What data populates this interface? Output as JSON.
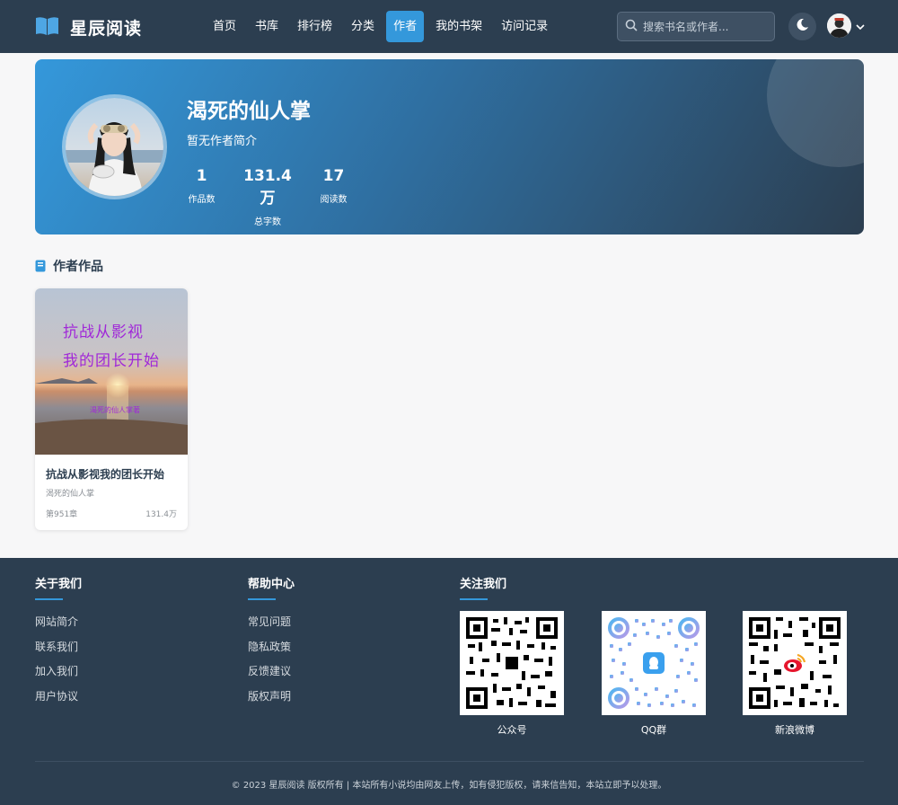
{
  "nav": {
    "logo_text": "星辰阅读",
    "menu": [
      {
        "label": "首页",
        "active": false
      },
      {
        "label": "书库",
        "active": false
      },
      {
        "label": "排行榜",
        "active": false
      },
      {
        "label": "分类",
        "active": false
      },
      {
        "label": "作者",
        "active": true
      },
      {
        "label": "我的书架",
        "active": false
      },
      {
        "label": "访问记录",
        "active": false
      }
    ],
    "search_placeholder": "搜索书名或作者...",
    "icons": [
      "book-open-icon",
      "search-icon",
      "moon-icon",
      "chevron-down-icon"
    ]
  },
  "author": {
    "name": "渴死的仙人掌",
    "intro": "暂无作者简介",
    "stats": [
      {
        "value": "1",
        "label": "作品数"
      },
      {
        "value": "131.4万",
        "label": "总字数"
      },
      {
        "value": "17",
        "label": "阅读数"
      }
    ]
  },
  "works": {
    "title": "作者作品",
    "books": [
      {
        "title": "抗战从影视我的团长开始",
        "author": "渴死的仙人掌",
        "chapter": "第951章",
        "words": "131.4万",
        "cover_line1": "抗战从影视",
        "cover_line2": "我的团长开始",
        "cover_author": "渴死的仙人掌",
        "cover_author_suffix": "著"
      }
    ]
  },
  "footer": {
    "about": {
      "title": "关于我们",
      "links": [
        "网站简介",
        "联系我们",
        "加入我们",
        "用户协议"
      ]
    },
    "help": {
      "title": "帮助中心",
      "links": [
        "常见问题",
        "隐私政策",
        "反馈建议",
        "版权声明"
      ]
    },
    "follow": {
      "title": "关注我们",
      "qrs": [
        {
          "label": "公众号"
        },
        {
          "label": "QQ群"
        },
        {
          "label": "新浪微博"
        }
      ]
    },
    "copyright": "© 2023 星辰阅读 版权所有 | 本站所有小说均由网友上传，如有侵犯版权，请来信告知，本站立即予以处理。"
  },
  "colors": {
    "primary": "#3498db",
    "dark": "#2c3e50",
    "background": "#f7f7f8"
  }
}
